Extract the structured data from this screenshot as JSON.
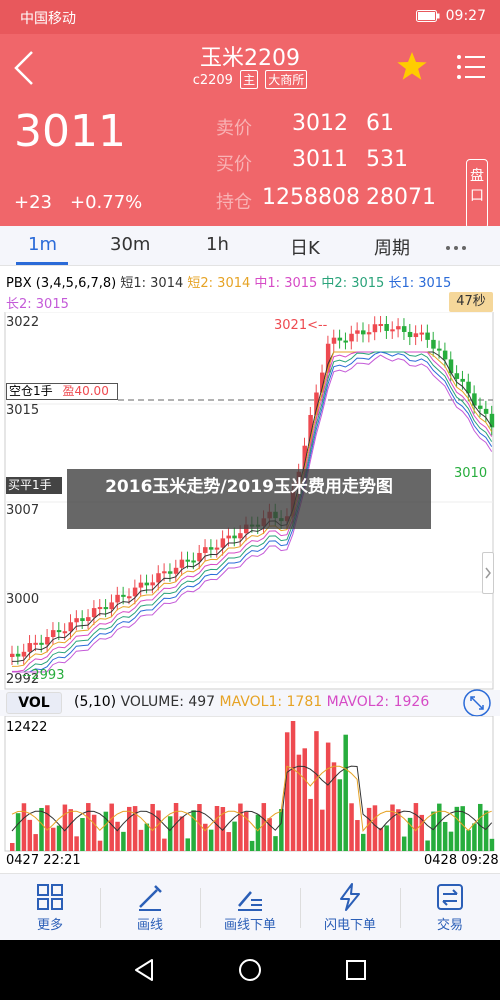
{
  "status": {
    "carrier": "中国移动",
    "time": "09:27"
  },
  "header": {
    "title": "玉米2209",
    "code": "c2209",
    "tag1": "主",
    "tag2": "大商所",
    "price": "3011",
    "change": "+23",
    "change_pct": "+0.77%",
    "quotes": [
      {
        "label": "卖价",
        "price": "3012",
        "qty": "61"
      },
      {
        "label": "买价",
        "price": "3011",
        "qty": "531"
      },
      {
        "label": "持仓",
        "price": "1258808",
        "qty": "28071"
      }
    ],
    "pan_label": "盘口"
  },
  "tabs": [
    "1m",
    "30m",
    "1h",
    "日K",
    "周期"
  ],
  "kline": {
    "legend": {
      "pbx": "PBX (3,4,5,6,7,8)",
      "s1": "短1: 3014",
      "s2": "短2: 3014",
      "m1": "中1: 3015",
      "m2": "中2: 3015",
      "l1": "长1: 3015",
      "l2": "长2: 3015"
    },
    "badge": "47秒",
    "y_labels": [
      "3022",
      "3015",
      "3007",
      "3000",
      "2992"
    ],
    "high_label": "3021<--",
    "low_label": "--2993",
    "last_label": "3010",
    "position": {
      "label": "空仓1手",
      "profit": "盈40.00"
    },
    "sell": "买平1手"
  },
  "overlay_title": "2016玉米走势/2019玉米费用走势图",
  "volume": {
    "button": "VOL",
    "params": "(5,10)",
    "volume": "VOLUME: 497",
    "mavol1": "MAVOL1: 1781",
    "mavol2": "MAVOL2: 1926",
    "max_label": "12422"
  },
  "time_start": "0427 22:21",
  "time_end": "0428 09:28",
  "toolbar": [
    "更多",
    "画线",
    "画线下单",
    "闪电下单",
    "交易"
  ],
  "colors": {
    "up": "#ee4a50",
    "down": "#27ad3d",
    "accent": "#2b6bd8",
    "header": "#f0666a"
  }
}
